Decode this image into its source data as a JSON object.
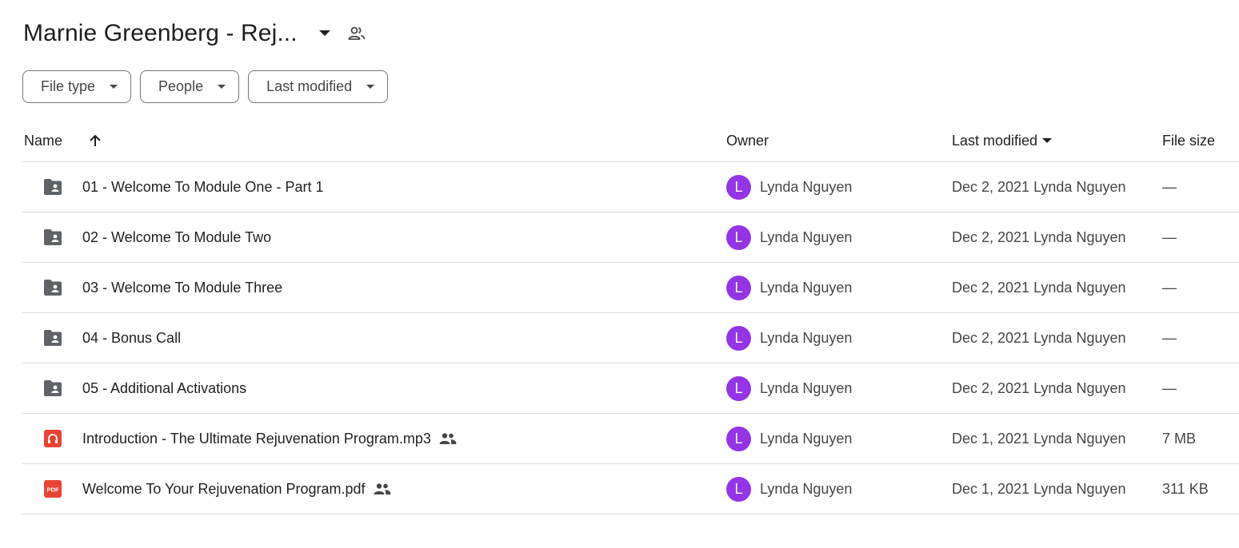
{
  "header": {
    "title": "Marnie Greenberg - Rej..."
  },
  "filters": [
    {
      "label": "File type"
    },
    {
      "label": "People"
    },
    {
      "label": "Last modified"
    }
  ],
  "table": {
    "columns": {
      "name": "Name",
      "owner": "Owner",
      "modified": "Last modified",
      "size": "File size"
    },
    "rows": [
      {
        "type": "shared-folder",
        "name": "01 - Welcome To Module One - Part 1",
        "shared": false,
        "owner_initial": "L",
        "owner": "Lynda Nguyen",
        "modified": "Dec 2, 2021 Lynda Nguyen",
        "size": "—"
      },
      {
        "type": "shared-folder",
        "name": "02 - Welcome To Module Two",
        "shared": false,
        "owner_initial": "L",
        "owner": "Lynda Nguyen",
        "modified": "Dec 2, 2021 Lynda Nguyen",
        "size": "—"
      },
      {
        "type": "shared-folder",
        "name": "03 - Welcome To Module Three",
        "shared": false,
        "owner_initial": "L",
        "owner": "Lynda Nguyen",
        "modified": "Dec 2, 2021 Lynda Nguyen",
        "size": "—"
      },
      {
        "type": "shared-folder",
        "name": "04 - Bonus Call",
        "shared": false,
        "owner_initial": "L",
        "owner": "Lynda Nguyen",
        "modified": "Dec 2, 2021 Lynda Nguyen",
        "size": "—"
      },
      {
        "type": "shared-folder",
        "name": "05 - Additional Activations",
        "shared": false,
        "owner_initial": "L",
        "owner": "Lynda Nguyen",
        "modified": "Dec 2, 2021 Lynda Nguyen",
        "size": "—"
      },
      {
        "type": "audio",
        "name": "Introduction - The Ultimate Rejuvenation Program.mp3",
        "shared": true,
        "owner_initial": "L",
        "owner": "Lynda Nguyen",
        "modified": "Dec 1, 2021 Lynda Nguyen",
        "size": "7 MB"
      },
      {
        "type": "pdf",
        "name": "Welcome To Your Rejuvenation Program.pdf",
        "shared": true,
        "owner_initial": "L",
        "owner": "Lynda Nguyen",
        "modified": "Dec 1, 2021 Lynda Nguyen",
        "size": "311 KB"
      }
    ]
  },
  "colors": {
    "avatar": "#9334e6",
    "folder_icon": "#5f6368",
    "file_icon_red": "#ea4335",
    "divider": "#dadce0"
  },
  "icons": {
    "title_dropdown": "caret-down-icon",
    "share": "people-icon",
    "sort": "arrow-up-icon",
    "folder": "shared-folder-icon",
    "audio": "audio-file-icon",
    "pdf": "pdf-file-icon",
    "shared": "shared-people-icon"
  }
}
